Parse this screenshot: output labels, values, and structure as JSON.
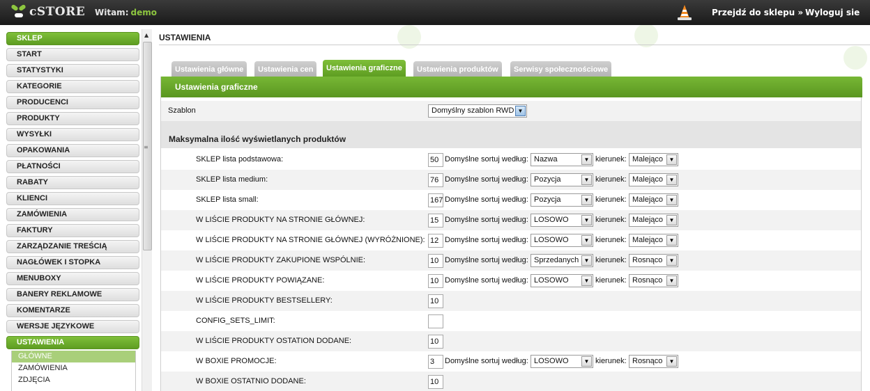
{
  "app": {
    "logo_text": "cSTORE",
    "welcome_label": "Witam:",
    "user": "demo"
  },
  "header": {
    "goto_shop": "Przejdź do sklepu »",
    "logout": "Wyloguj sie",
    "cone_icon": "vlc-cone-icon"
  },
  "sidebar": {
    "items": [
      {
        "label": "SKLEP",
        "active": true
      },
      {
        "label": "START"
      },
      {
        "label": "STATYSTYKI"
      },
      {
        "label": "KATEGORIE"
      },
      {
        "label": "PRODUCENCI"
      },
      {
        "label": "PRODUKTY"
      },
      {
        "label": "WYSYŁKI"
      },
      {
        "label": "OPAKOWANIA"
      },
      {
        "label": "PŁATNOŚCI"
      },
      {
        "label": "RABATY"
      },
      {
        "label": "KLIENCI"
      },
      {
        "label": "ZAMÓWIENIA"
      },
      {
        "label": "FAKTURY"
      },
      {
        "label": "ZARZĄDZANIE TREŚCIĄ"
      },
      {
        "label": "NAGŁÓWEK I STOPKA"
      },
      {
        "label": "MENUBOXY"
      },
      {
        "label": "BANERY REKLAMOWE"
      },
      {
        "label": "KOMENTARZE"
      },
      {
        "label": "WERSJE JĘZYKOWE"
      },
      {
        "label": "USTAWIENIA",
        "active": true
      }
    ],
    "subitems": [
      {
        "label": "GŁÓWNE",
        "active": true
      },
      {
        "label": "ZAMÓWIENIA"
      },
      {
        "label": "ZDJĘCIA"
      }
    ]
  },
  "main": {
    "title": "USTAWIENIA",
    "tabs": [
      {
        "label": "Ustawienia główne"
      },
      {
        "label": "Ustawienia cen"
      },
      {
        "label": "Ustawienia graficzne",
        "active": true
      },
      {
        "label": "Ustawienia produktów"
      },
      {
        "label": "Serwisy społecznościowe"
      }
    ],
    "panel_title": "Ustawienia graficzne",
    "template_label": "Szablon",
    "template_value": "Domyślny szablon RWD",
    "section_title": "Maksymalna ilość wyświetlanych produktów",
    "sort_label": "Domyślne sortuj według:",
    "direction_label": "kierunek:",
    "rows": [
      {
        "label": "SKLEP lista podstawowa:",
        "value": "50",
        "sort": "Nazwa",
        "dir": "Malejąco"
      },
      {
        "label": "SKLEP lista medium:",
        "value": "76",
        "sort": "Pozycja",
        "dir": "Malejąco"
      },
      {
        "label": "SKLEP lista small:",
        "value": "167",
        "sort": "Pozycja",
        "dir": "Malejąco"
      },
      {
        "label": "W LIŚCIE PRODUKTY NA STRONIE GŁÓWNEJ:",
        "value": "15",
        "sort": "LOSOWO",
        "dir": "Malejąco"
      },
      {
        "label": "W LIŚCIE PRODUKTY NA STRONIE GŁÓWNEJ (WYRÓŻNIONE):",
        "value": "12",
        "sort": "LOSOWO",
        "dir": "Malejąco"
      },
      {
        "label": "W LIŚCIE PRODUKTY ZAKUPIONE WSPÓLNIE:",
        "value": "10",
        "sort": "Sprzedanych",
        "dir": "Rosnąco"
      },
      {
        "label": "W LIŚCIE PRODUKTY POWIĄZANE:",
        "value": "10",
        "sort": "LOSOWO",
        "dir": "Rosnąco"
      },
      {
        "label": "W LIŚCIE PRODUKTY BESTSELLERY:",
        "value": "10"
      },
      {
        "label": "CONFIG_SETS_LIMIT:",
        "value": ""
      },
      {
        "label": "W LIŚCIE PRODUKTY OSTATION DODANE:",
        "value": "10"
      },
      {
        "label": "W BOXIE PROMOCJE:",
        "value": "3",
        "sort": "LOSOWO",
        "dir": "Rosnąco"
      },
      {
        "label": "W BOXIE OSTATNIO DODANE:",
        "value": "10"
      }
    ]
  },
  "colors": {
    "accent": "#6aaa2c",
    "topbar": "#262626"
  }
}
